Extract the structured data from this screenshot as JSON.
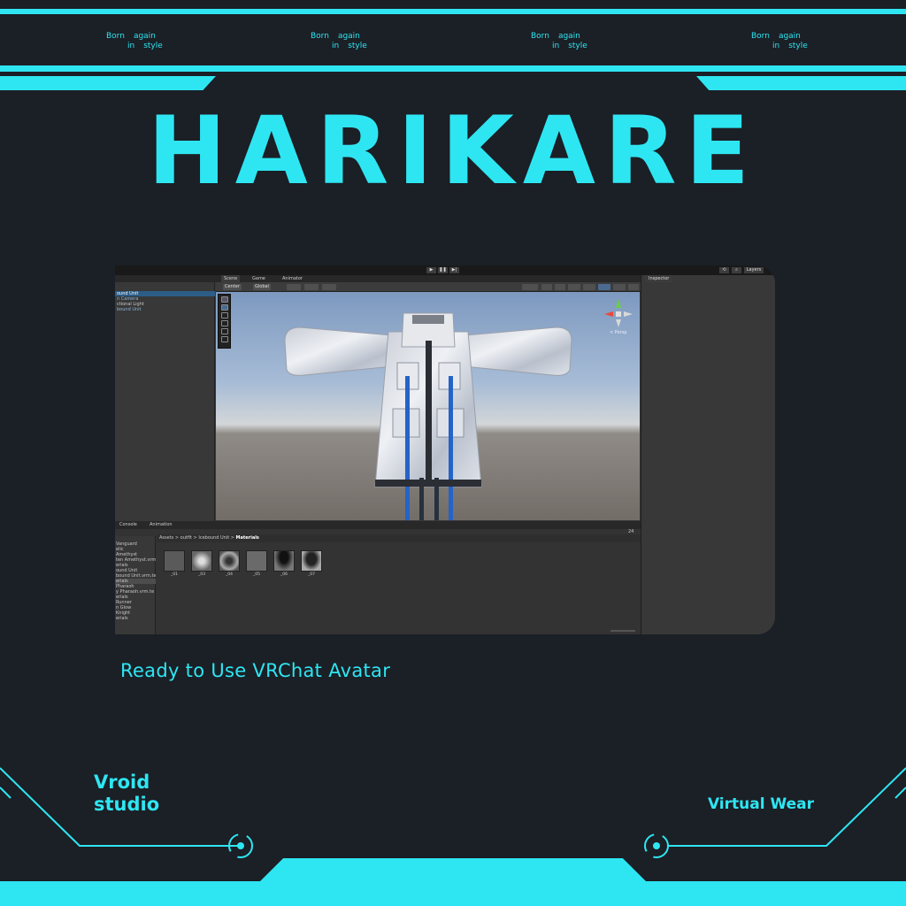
{
  "taglines": [
    {
      "w1": "Born",
      "w2": "again",
      "w3": "in",
      "w4": "style"
    },
    {
      "w1": "Born",
      "w2": "again",
      "w3": "in",
      "w4": "style"
    },
    {
      "w1": "Born",
      "w2": "again",
      "w3": "in",
      "w4": "style"
    },
    {
      "w1": "Born",
      "w2": "again",
      "w3": "in",
      "w4": "style"
    }
  ],
  "brand_title": "HARIKARE",
  "subtitle": "Ready to Use VRChat Avatar",
  "footer": {
    "left_line1": "Vroid",
    "left_line2": "studio",
    "right": "Virtual Wear"
  },
  "colors": {
    "accent": "#2ee6f2",
    "background": "#1b1f26"
  },
  "editor": {
    "toolbar": {
      "play": "▶",
      "pause": "❚❚",
      "step": "▶|",
      "layers": "Layers"
    },
    "tabs": [
      "Scene",
      "Game",
      "Animator"
    ],
    "inspector_tab": "Inspector",
    "scene_toolbar": {
      "center": "Center",
      "global": "Global"
    },
    "hierarchy": [
      "ound Unit",
      "n Camera",
      "ctional Light",
      "bound Unit"
    ],
    "gizmo_label": "< Persp",
    "bottom_tabs": [
      "Console",
      "Animation"
    ],
    "breadcrumb": {
      "a": "Assets",
      "b": "outfit",
      "c": "Icebound Unit",
      "d": "Materials"
    },
    "project_tree": [
      "Vanguard",
      "elic",
      "Amethyst",
      "ten Amethyst.vrm",
      "erials",
      "ound Unit",
      "bound Unit.vrm.te",
      "erials",
      "Pharaoh",
      "y Pharaoh.vrm.te",
      "erials",
      "Runner",
      "n Glow",
      "Knight",
      "erials"
    ],
    "materials": [
      "_01",
      "_03",
      "_04",
      "_05",
      "_06",
      "_07"
    ],
    "count_badge": "24"
  }
}
